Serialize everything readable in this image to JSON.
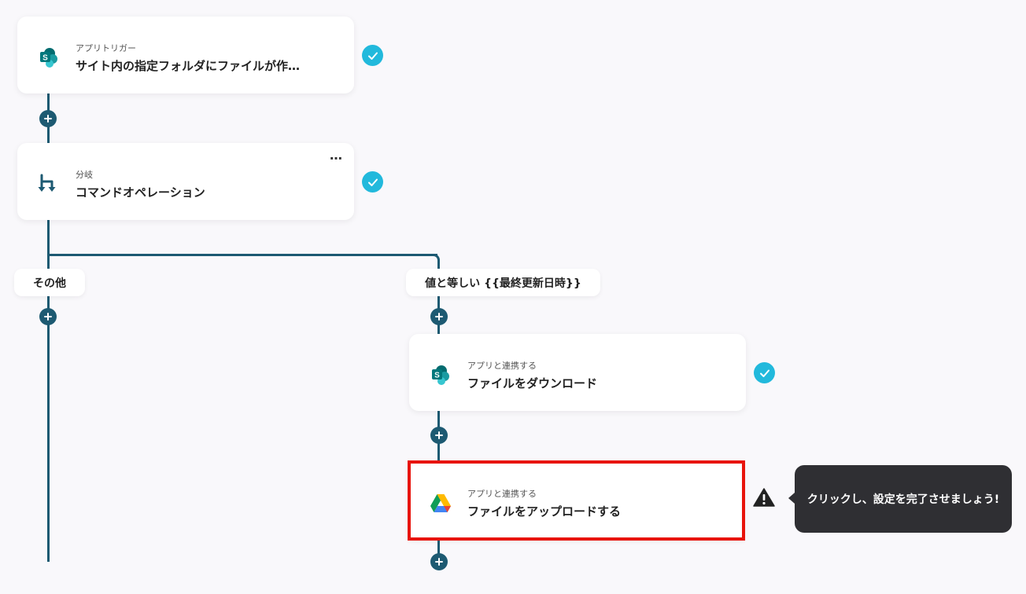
{
  "flow": {
    "trigger": {
      "category": "アプリトリガー",
      "title": "サイト内の指定フォルダにファイルが作…",
      "app_icon": "sharepoint-icon"
    },
    "branch": {
      "category": "分岐",
      "title": "コマンドオペレーション",
      "more": "…",
      "app_icon": "branch-icon"
    },
    "branch_labels": {
      "other": "その他",
      "equals": "値と等しい {{最終更新日時}}"
    },
    "download": {
      "category": "アプリと連携する",
      "title": "ファイルをダウンロード",
      "app_icon": "sharepoint-icon"
    },
    "upload": {
      "category": "アプリと連携する",
      "title": "ファイルをアップロードする",
      "app_icon": "google-drive-icon"
    }
  },
  "tooltip": {
    "text": "クリックし、設定を完了させましょう!"
  },
  "colors": {
    "line": "#1d5a72",
    "check": "#22b9dc",
    "highlight": "#e8140c",
    "tooltip_bg": "#2f2f33"
  }
}
